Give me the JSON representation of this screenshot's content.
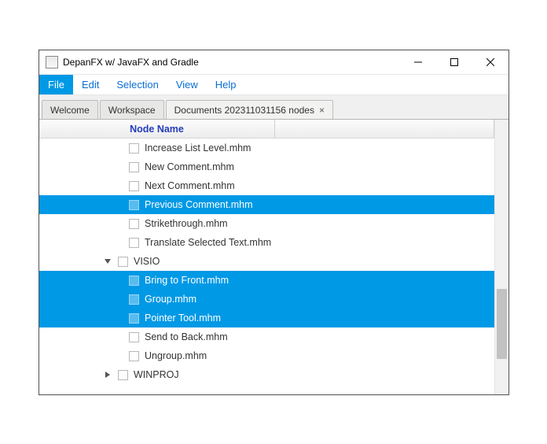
{
  "window": {
    "title": "DepanFX w/ JavaFX and Gradle"
  },
  "menu": {
    "items": [
      {
        "label": "File",
        "active": true
      },
      {
        "label": "Edit",
        "active": false
      },
      {
        "label": "Selection",
        "active": false
      },
      {
        "label": "View",
        "active": false
      },
      {
        "label": "Help",
        "active": false
      }
    ]
  },
  "tabs": {
    "items": [
      {
        "label": "Welcome",
        "closable": false,
        "active": false
      },
      {
        "label": "Workspace",
        "closable": false,
        "active": false
      },
      {
        "label": "Documents 202311031156 nodes",
        "closable": true,
        "active": true
      }
    ]
  },
  "columns": {
    "name": "Node Name"
  },
  "tree": {
    "rows": [
      {
        "indent": 114,
        "arrow": "",
        "label": "Increase List Level.mhm",
        "selected": false
      },
      {
        "indent": 114,
        "arrow": "",
        "label": "New Comment.mhm",
        "selected": false
      },
      {
        "indent": 114,
        "arrow": "",
        "label": "Next Comment.mhm",
        "selected": false
      },
      {
        "indent": 114,
        "arrow": "",
        "label": "Previous Comment.mhm",
        "selected": true
      },
      {
        "indent": 114,
        "arrow": "",
        "label": "Strikethrough.mhm",
        "selected": false
      },
      {
        "indent": 114,
        "arrow": "",
        "label": "Translate Selected Text.mhm",
        "selected": false
      },
      {
        "indent": 80,
        "arrow": "down",
        "label": "VISIO",
        "selected": false
      },
      {
        "indent": 114,
        "arrow": "",
        "label": "Bring to Front.mhm",
        "selected": true
      },
      {
        "indent": 114,
        "arrow": "",
        "label": "Group.mhm",
        "selected": true
      },
      {
        "indent": 114,
        "arrow": "",
        "label": "Pointer Tool.mhm",
        "selected": true
      },
      {
        "indent": 114,
        "arrow": "",
        "label": "Send to Back.mhm",
        "selected": false
      },
      {
        "indent": 114,
        "arrow": "",
        "label": "Ungroup.mhm",
        "selected": false
      },
      {
        "indent": 80,
        "arrow": "right",
        "label": "WINPROJ",
        "selected": false
      }
    ]
  }
}
